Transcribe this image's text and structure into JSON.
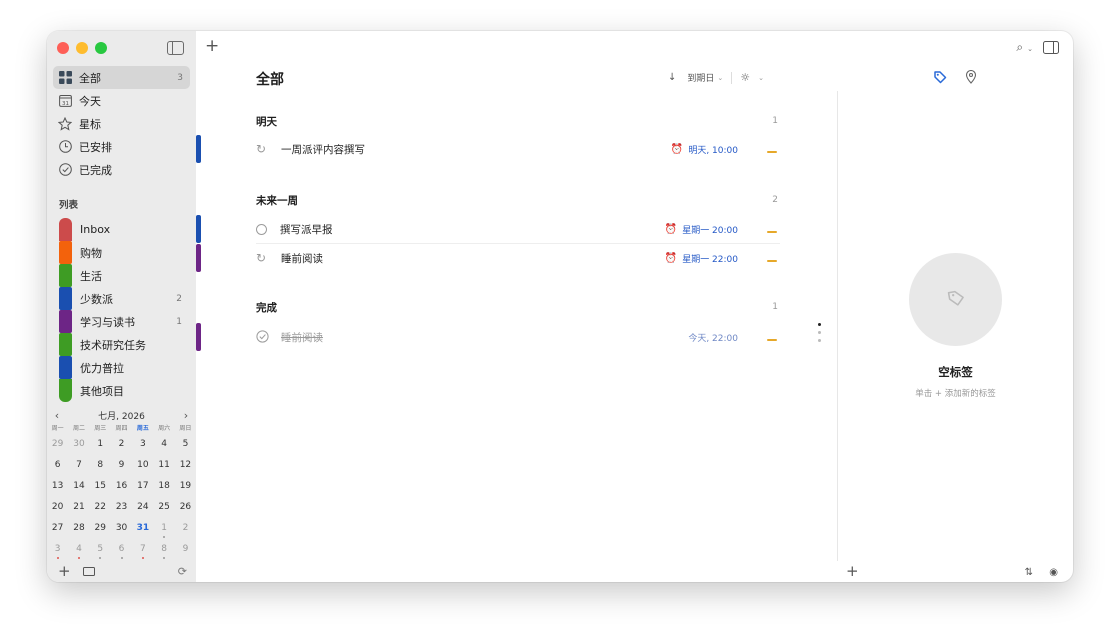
{
  "sidebar": {
    "nav": [
      {
        "label": "全部",
        "count": "3",
        "icon": "grid-icon"
      },
      {
        "label": "今天",
        "count": "",
        "icon": "calendar-31-icon"
      },
      {
        "label": "星标",
        "count": "",
        "icon": "star-icon"
      },
      {
        "label": "已安排",
        "count": "",
        "icon": "clock-icon"
      },
      {
        "label": "已完成",
        "count": "",
        "icon": "check-circle-icon"
      }
    ],
    "lists_title": "列表",
    "lists": [
      {
        "label": "Inbox",
        "count": "",
        "color": "#cc4b4b"
      },
      {
        "label": "购物",
        "count": "",
        "color": "#f3620c"
      },
      {
        "label": "生活",
        "count": "",
        "color": "#3e9c24"
      },
      {
        "label": "少数派",
        "count": "2",
        "color": "#1a4fb0"
      },
      {
        "label": "学习与读书",
        "count": "1",
        "color": "#6d2586"
      },
      {
        "label": "技术研究任务",
        "count": "",
        "color": "#3e9c24"
      },
      {
        "label": "优力普拉",
        "count": "",
        "color": "#1a4fb0"
      },
      {
        "label": "其他项目",
        "count": "",
        "color": "#3e9c24"
      }
    ],
    "calendar": {
      "month": "七月, 2026",
      "weekdays": [
        "周一",
        "周二",
        "周三",
        "周四",
        "周五",
        "周六",
        "周日"
      ],
      "weeks": [
        [
          "29",
          "30",
          "1",
          "2",
          "3",
          "4",
          "5"
        ],
        [
          "6",
          "7",
          "8",
          "9",
          "10",
          "11",
          "12"
        ],
        [
          "13",
          "14",
          "15",
          "16",
          "17",
          "18",
          "19"
        ],
        [
          "20",
          "21",
          "22",
          "23",
          "24",
          "25",
          "26"
        ],
        [
          "27",
          "28",
          "29",
          "30",
          "31",
          "1",
          "2"
        ],
        [
          "3",
          "4",
          "5",
          "6",
          "7",
          "8",
          "9"
        ]
      ]
    }
  },
  "main": {
    "title": "全部",
    "sort_label": "到期日",
    "groups": [
      {
        "title": "明天",
        "count": "1",
        "tasks": [
          {
            "title": "一周派评内容撰写",
            "due": "明天, 10:00",
            "alarm": true,
            "type": "repeat",
            "tag_color": "#1a4fb0"
          }
        ]
      },
      {
        "title": "未来一周",
        "count": "2",
        "tasks": [
          {
            "title": "撰写派早报",
            "due": "星期一 20:00",
            "alarm": true,
            "type": "circle",
            "tag_color": "#1a4fb0"
          },
          {
            "title": "睡前阅读",
            "due": "星期一 22:00",
            "alarm": true,
            "type": "repeat",
            "tag_color": "#6d2586"
          }
        ]
      },
      {
        "title": "完成",
        "count": "1",
        "tasks": [
          {
            "title": "睡前阅读",
            "due": "今天, 22:00",
            "alarm": false,
            "type": "done",
            "tag_color": "#6d2586"
          }
        ]
      }
    ]
  },
  "right_panel": {
    "empty_title": "空标签",
    "empty_subtitle": "单击 + 添加新的标签"
  },
  "colors": {
    "accent": "#2a6ad8",
    "priority": "#e6a82a",
    "alarm": "#e2a516"
  }
}
